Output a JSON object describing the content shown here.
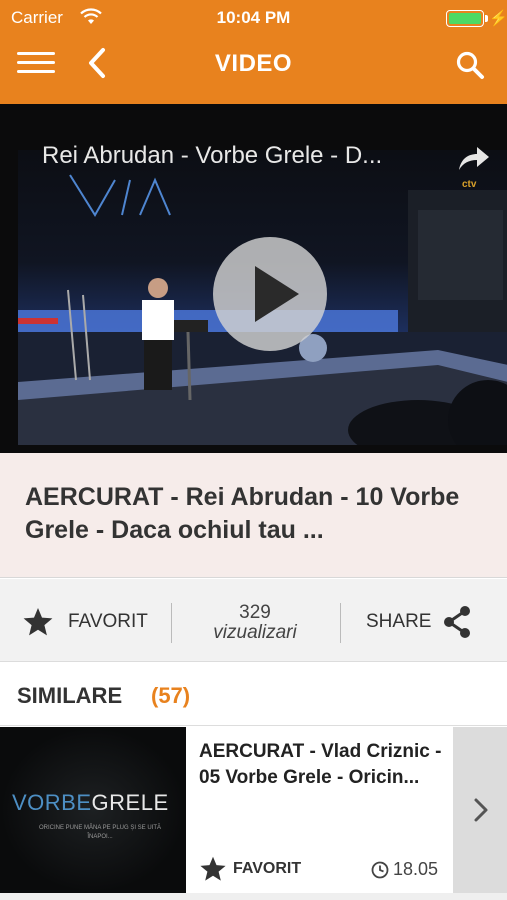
{
  "status_bar": {
    "carrier": "Carrier",
    "time": "10:04 PM",
    "battery_level": 1.0
  },
  "nav": {
    "title": "VIDEO"
  },
  "player": {
    "overlay_title": "Rei Abrudan - Vorbe Grele - D...",
    "wall_sign": "V I A",
    "channel_logo": "ctv"
  },
  "video": {
    "title": "AERCURAT - Rei Abrudan - 10 Vorbe Grele - Daca ochiul tau ..."
  },
  "actions": {
    "favorite_label": "FAVORIT",
    "views_count": "329",
    "views_label": "vizualizari",
    "share_label": "SHARE"
  },
  "similar": {
    "label": "SIMILARE",
    "count": "(57)",
    "items": [
      {
        "title": "AERCURAT - Vlad Criznic - 05 Vorbe Grele - Oricin...",
        "thumb_brand_a": "VORBE",
        "thumb_brand_b": "GRELE",
        "thumb_tagline": "ORICINE PUNE MÂNA PE PLUG ȘI SE UITĂ ÎNAPOI...",
        "favorite_label": "FAVORIT",
        "duration": "18.05"
      }
    ]
  },
  "colors": {
    "accent": "#e8821e",
    "battery": "#4cd964"
  },
  "icons": [
    "menu-icon",
    "back-icon",
    "search-icon",
    "share-arrow-icon",
    "play-icon",
    "star-icon",
    "share-icon",
    "clock-icon",
    "chevron-right-icon"
  ]
}
